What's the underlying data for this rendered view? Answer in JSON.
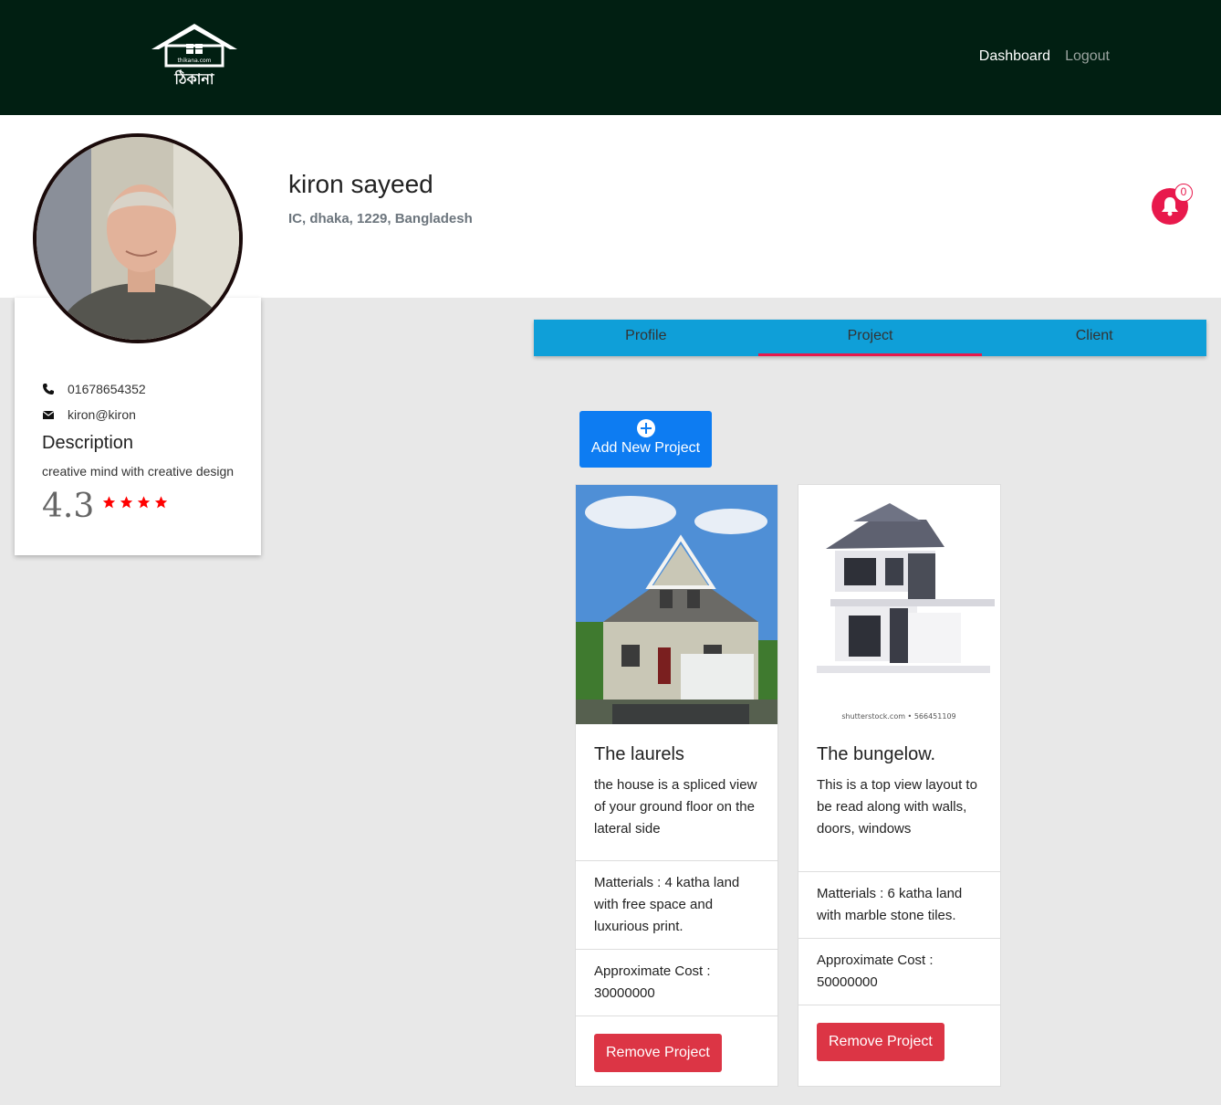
{
  "nav": {
    "logo_text": "ঠিকানা",
    "logo_small": "thikana.com",
    "links": [
      {
        "label": "Dashboard"
      },
      {
        "label": "Logout"
      }
    ]
  },
  "profile": {
    "name": "kiron sayeed",
    "address": "IC, dhaka, 1229, Bangladesh",
    "phone": "01678654352",
    "email": "kiron@kiron",
    "description_title": "Description",
    "description": "creative mind with creative design",
    "rating": "4.3",
    "rating_stars": 4,
    "notification_count": "0"
  },
  "tabs": [
    {
      "label": "Profile"
    },
    {
      "label": "Project"
    },
    {
      "label": "Client"
    }
  ],
  "active_tab": "Project",
  "add_project_label": "Add New Project",
  "projects": [
    {
      "title": "The laurels",
      "description": "the house is a spliced view of your ground floor on the lateral side",
      "materials": "Matterials : 4 katha land with free space and luxurious print.",
      "cost": "Approximate Cost : 30000000",
      "remove_label": "Remove Project"
    },
    {
      "title": "The bungelow.",
      "description": "This is a top view layout to be read along with walls, doors, windows",
      "materials": "Matterials : 6 katha land with marble stone tiles.",
      "cost": "Approximate Cost : 50000000",
      "remove_label": "Remove Project",
      "image_caption": "shutterstock.com • 566451109"
    }
  ],
  "colors": {
    "navbar": "#011f12",
    "tabs": "#0f9fd8",
    "accent": "#e8194c",
    "primary": "#0d7cf2",
    "danger": "#dc3545"
  }
}
